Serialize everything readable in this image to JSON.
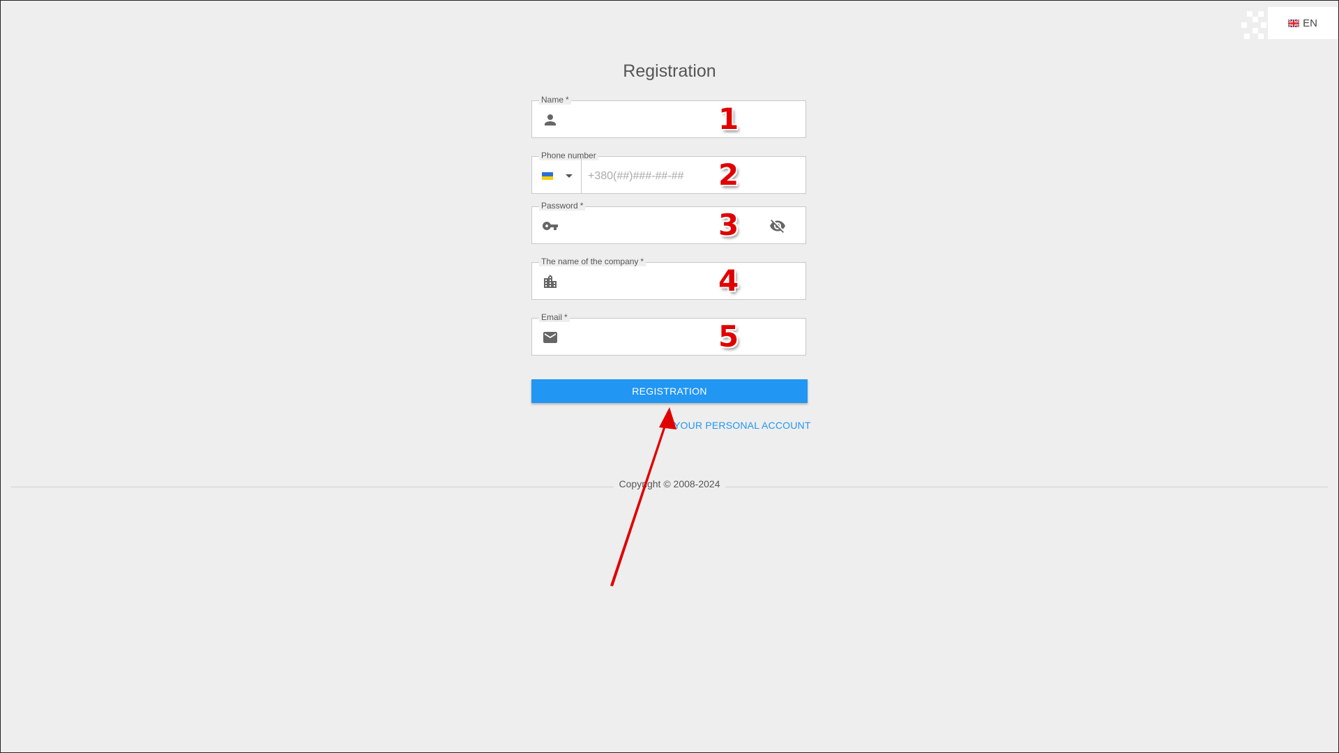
{
  "language": {
    "code": "EN"
  },
  "form": {
    "title": "Registration",
    "name": {
      "label": "Name",
      "required": "*"
    },
    "phone": {
      "label": "Phone number",
      "placeholder": "+380(##)###-##-##",
      "country": "UA"
    },
    "password": {
      "label": "Password",
      "required": "*"
    },
    "company": {
      "label": "The name of the company",
      "required": "*"
    },
    "email": {
      "label": "Email",
      "required": "*"
    },
    "submit_label": "REGISTRATION",
    "account_link": "YOUR PERSONAL ACCOUNT"
  },
  "annotations": {
    "n1": "1",
    "n2": "2",
    "n3": "3",
    "n4": "4",
    "n5": "5"
  },
  "footer": {
    "copyright": "Copyright © 2008-2024"
  },
  "colors": {
    "accent": "#2196f3",
    "background": "#eeeeee",
    "annotation_red": "#e00000"
  }
}
